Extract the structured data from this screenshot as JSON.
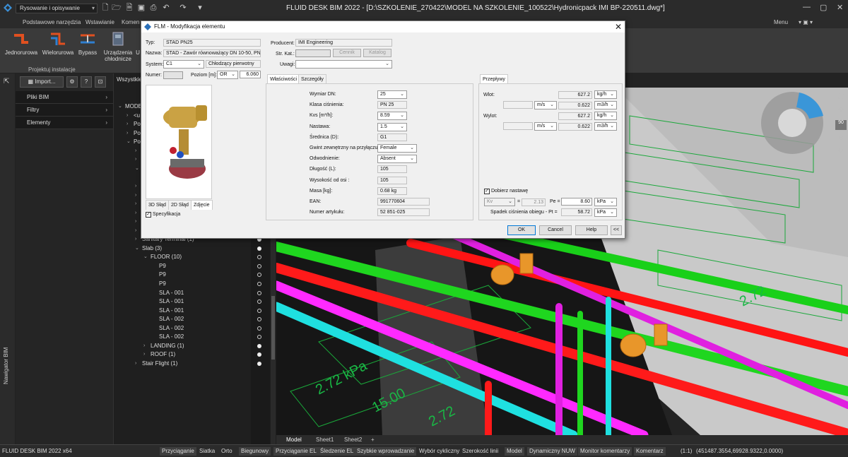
{
  "app": {
    "title": "FLUID DESK BIM 2022 - [D:\\SZKOLENIE_270422\\MODEL NA SZKOLENIE_100522\\Hydronicpack IMI BP-220511.dwg*]",
    "workspace": "Rysowanie i opisywanie",
    "menu_label": "Menu"
  },
  "ribbon": {
    "tabs": [
      "Podstawowe narzędzia",
      "Wstawianie",
      "Komen"
    ],
    "buttons": [
      "Jednorurowa",
      "Wielorurowa",
      "Bypass",
      "Urządzenia chłodnicze",
      "U"
    ],
    "group_label": "Projektuj instalacje"
  },
  "left_panel": {
    "import_label": "Import...",
    "help_label": "?",
    "rows": [
      "Pliki BIM",
      "Filtry",
      "Elementy"
    ],
    "side_label": "Nawigator BIM"
  },
  "tree": {
    "header": "Wszystkie",
    "items": [
      {
        "t": "MODEL",
        "lvl": 0,
        "car": "v"
      },
      {
        "t": "<u",
        "lvl": 1,
        "car": ">"
      },
      {
        "t": "Poz",
        "lvl": 1,
        "car": ">"
      },
      {
        "t": "Poz",
        "lvl": 1,
        "car": ">"
      },
      {
        "t": "Poz",
        "lvl": 1,
        "car": "v"
      },
      {
        "t": "",
        "lvl": 2,
        "car": ">"
      },
      {
        "t": "",
        "lvl": 2,
        "car": ">"
      },
      {
        "t": "",
        "lvl": 2,
        "car": "v"
      },
      {
        "t": "FLOORING (32)",
        "lvl": 3,
        "car": ">"
      },
      {
        "t": "Door (1)",
        "lvl": 2,
        "car": ">"
      },
      {
        "t": "Furniture (1)",
        "lvl": 2,
        "car": ">"
      },
      {
        "t": "Lamp (1)",
        "lvl": 2,
        "car": ">"
      },
      {
        "t": "Member (1)",
        "lvl": 2,
        "car": ">"
      },
      {
        "t": "Plate (1)",
        "lvl": 2,
        "car": ">"
      },
      {
        "t": "Railing (1)",
        "lvl": 2,
        "car": ">"
      },
      {
        "t": "Sanitary Terminal (1)",
        "lvl": 2,
        "car": ">"
      },
      {
        "t": "Slab (3)",
        "lvl": 2,
        "car": "v"
      },
      {
        "t": "FLOOR (10)",
        "lvl": 3,
        "car": "v"
      },
      {
        "t": "P9",
        "lvl": 4,
        "car": ""
      },
      {
        "t": "P9",
        "lvl": 4,
        "car": ""
      },
      {
        "t": "P9",
        "lvl": 4,
        "car": ""
      },
      {
        "t": "SLA - 001",
        "lvl": 4,
        "car": ""
      },
      {
        "t": "SLA - 001",
        "lvl": 4,
        "car": ""
      },
      {
        "t": "SLA - 001",
        "lvl": 4,
        "car": ""
      },
      {
        "t": "SLA - 002",
        "lvl": 4,
        "car": ""
      },
      {
        "t": "SLA - 002",
        "lvl": 4,
        "car": ""
      },
      {
        "t": "SLA - 002",
        "lvl": 4,
        "car": ""
      },
      {
        "t": "LANDING (1)",
        "lvl": 3,
        "car": ">"
      },
      {
        "t": "ROOF (1)",
        "lvl": 3,
        "car": ">"
      },
      {
        "t": "Stair Flight (1)",
        "lvl": 2,
        "car": ">"
      }
    ]
  },
  "dialog": {
    "title": "FLM - Modyfikacja elementu",
    "typ_label": "Typ:",
    "typ": "STAD PN25",
    "nazwa_label": "Nazwa:",
    "nazwa": "STAD - Zawór równoważący DN 10-50, PN",
    "system_label": "System:",
    "system": "C1",
    "system_name": "Chłodzący pierwotny",
    "numer_label": "Numer:",
    "poziom_label": "Poziom [m]:",
    "poziom_ref": "OR",
    "poziom": "6.060",
    "image_tabs": [
      "3D Słąd",
      "2D Słąd",
      "Zdjęcie"
    ],
    "specyfikacja": "Specyfikacja",
    "producent_label": "Producent:",
    "producent": "IMI Engineering",
    "strkat_label": "Str. Kat.:",
    "cennik": "Cennik",
    "katalog": "Katalog",
    "uwagi_label": "Uwagi:",
    "tabs": [
      "Właściwości",
      "Szczegóły"
    ],
    "props": [
      {
        "label": "Wymiar DN:",
        "value": "25",
        "kind": "sel"
      },
      {
        "label": "Klasa ciśnienia:",
        "value": "PN 25",
        "kind": "ro"
      },
      {
        "label": "Kvs [m³/h]:",
        "value": "8.59",
        "kind": "sel"
      },
      {
        "label": "Nastawa:",
        "value": "1.5",
        "kind": "sel"
      },
      {
        "label": "Średnica (D):",
        "value": "G1",
        "kind": "ro"
      },
      {
        "label": "Gwint zewnętrzny na przyłączu:",
        "value": "Female",
        "kind": "selw"
      },
      {
        "label": "Odwodnienie:",
        "value": "Absent",
        "kind": "selw"
      },
      {
        "label": "Długość (L):",
        "value": "105",
        "kind": "ro"
      },
      {
        "label": "Wysokość od osi :",
        "value": "105",
        "kind": "ro"
      },
      {
        "label": "Masa [kg]:",
        "value": "0.68 kg",
        "kind": "ro"
      },
      {
        "label": "EAN:",
        "value": "991770604",
        "kind": "row"
      },
      {
        "label": "Numer artykułu:",
        "value": "52 851-025",
        "kind": "row"
      }
    ],
    "flow_tab": "Przepływy",
    "wlot_label": "Wlot:",
    "wylot_label": "Wylot:",
    "wlot_kgh": "627.2",
    "wlot_m3h": "0.622",
    "wylot_kgh": "627.2",
    "wylot_m3h": "0.622",
    "unit_kgh": "kg/h",
    "unit_m3h": "m3/h",
    "unit_ms": "m/s",
    "dobierz": "Dobierz nastawę",
    "kv_label": "Kv",
    "kv_eq": "=",
    "kv_value": "2.13",
    "pe_label": "Pe =",
    "pe_value": "8.60",
    "unit_kpa": "kPa",
    "spadek_label": "Spadek ciśnienia obiegu - Pt =",
    "spadek_value": "58.72",
    "ok": "OK",
    "cancel": "Cancel",
    "help": "Help",
    "collapse": "<<"
  },
  "viewport": {
    "nav_value": "90",
    "labels": [
      "2.72 kPa",
      "15.00",
      "2.72",
      "2.72"
    ]
  },
  "sheet_tabs": [
    "Model",
    "Sheet1",
    "Sheet2",
    "+"
  ],
  "status": {
    "left": "FLUID DESK BIM 2022 x64",
    "items": [
      "Przyciąganie",
      "Siatka",
      "Orto",
      "Biegunowy",
      "Przyciąganie EL",
      "Śledzenie EL",
      "Szybkie wprowadzanie",
      "Wybór cykliczny",
      "Szerokość linii",
      "Model",
      "Dynamiczny NUW",
      "Monitor komentarzy",
      "Komentarz"
    ],
    "scale": "(1:1)",
    "coords": "(451487.3554,69928.9322,0.0000)"
  }
}
